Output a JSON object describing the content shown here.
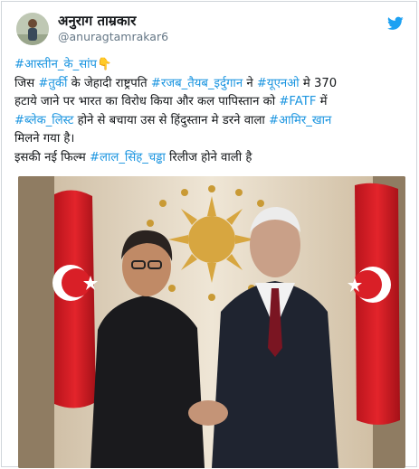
{
  "tweet": {
    "display_name": "अनुराग ताम्रकार",
    "handle": "@anuragtamrakar6",
    "line1": {
      "hashtag": "#आस्तीन_के_सांप",
      "emoji": "👇"
    },
    "line2": {
      "t1": "जिस ",
      "h1": "#तुर्की",
      "t2": " के जेहादी राष्ट्रपति ",
      "h2": "#रजब_तैयब_इर्दुगान",
      "t3": " ने ",
      "h3": "#यूएनओ",
      "t4": " मे 370"
    },
    "line3": {
      "t1": "हटाये जाने पर भारत का विरोध किया और कल पापिस्तान को ",
      "h1": "#FATF",
      "t2": " में"
    },
    "line4": {
      "h1": "#ब्लेक_लिस्ट",
      "t1": " होने से बचाया उस से हिंदुस्तान मे डरने वाला ",
      "h2": "#आमिर_खान"
    },
    "line5": {
      "t1": " मिलने गया है।"
    },
    "line6": {
      "t1": "इसकी नई फिल्म ",
      "h1": "#लाल_सिंह_चड्ढा",
      "t2": " रिलीज होने वाली है"
    }
  },
  "icons": {
    "platform": "twitter-bird-icon",
    "brand_color": "#1da1f2",
    "hashtag_color": "#1b95e0"
  }
}
